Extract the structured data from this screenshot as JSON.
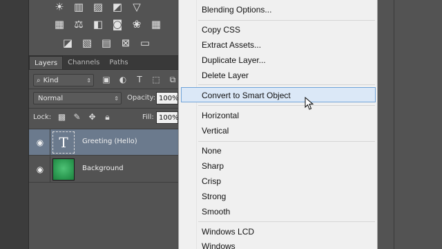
{
  "adjustments": {
    "row1": [
      "sun-icon",
      "levels-icon",
      "curves-icon",
      "exposure-icon",
      "triangle-icon"
    ],
    "row2": [
      "vibrance-icon",
      "balance-icon",
      "bw-icon",
      "camera-icon",
      "mixer-icon",
      "grid-icon"
    ],
    "row3": [
      "invert-icon",
      "posterize-icon",
      "threshold-icon",
      "selective-icon",
      "gradient-icon"
    ]
  },
  "layers_panel": {
    "tabs": [
      {
        "label": "Layers",
        "active": true
      },
      {
        "label": "Channels",
        "active": false
      },
      {
        "label": "Paths",
        "active": false
      }
    ],
    "filter": {
      "value": "Kind"
    },
    "blend_mode": "Normal",
    "opacity_label": "Opacity:",
    "opacity": "100%",
    "lock_label": "Lock:",
    "fill_label": "Fill:",
    "fill": "100%",
    "layers": [
      {
        "name": "Greeting (Hello)",
        "thumb": "T",
        "selected": true
      },
      {
        "name": "Background",
        "selected": false
      }
    ]
  },
  "context_menu": {
    "items": [
      "Blending Options...",
      "Copy CSS",
      "Extract Assets...",
      "Duplicate Layer...",
      "Delete Layer",
      "Convert to Smart Object",
      "Horizontal",
      "Vertical",
      "None",
      "Sharp",
      "Crisp",
      "Strong",
      "Smooth",
      "Windows LCD",
      "Windows"
    ],
    "highlighted": "Convert to Smart Object"
  },
  "colors": {
    "panel": "#535353",
    "selection": "#6b7a8d",
    "menu_bg": "#f0f0f0",
    "menu_highlight": "#dbe8f7",
    "menu_highlight_border": "#6fa3d8"
  }
}
